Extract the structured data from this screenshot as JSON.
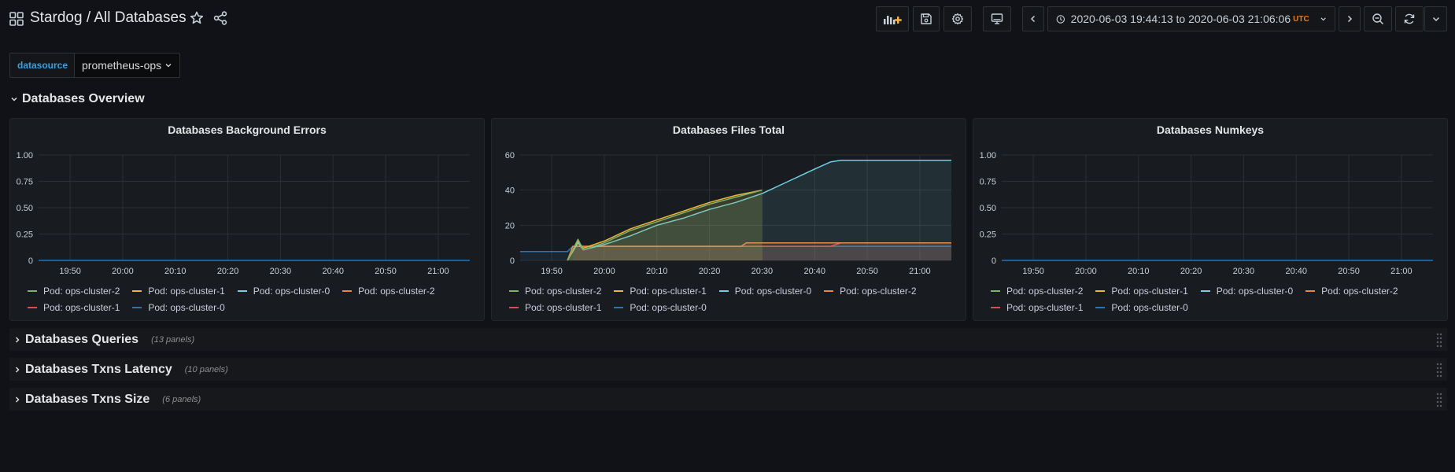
{
  "header": {
    "title": "Stardog / All Databases",
    "time_range": {
      "text": "2020-06-03 19:44:13 to 2020-06-03 21:06:06",
      "tz": "UTC"
    }
  },
  "variables": {
    "label": "datasource",
    "value": "prometheus-ops"
  },
  "rows": {
    "overview": {
      "title": "Databases Overview"
    },
    "collapsed": [
      {
        "title": "Databases Queries",
        "count": "(13 panels)"
      },
      {
        "title": "Databases Txns Latency",
        "count": "(10 panels)"
      },
      {
        "title": "Databases Txns Size",
        "count": "(6 panels)"
      }
    ]
  },
  "colors": {
    "ops-cluster-2-green": "#7eb26d",
    "ops-cluster-1-yellow": "#eab839",
    "ops-cluster-0-cyan": "#6ed0e0",
    "ops-cluster-2-orange": "#ef843c",
    "ops-cluster-1-red": "#e24d42",
    "ops-cluster-0-blue": "#1f78c1"
  },
  "panels": [
    {
      "title": "Databases Background Errors",
      "legend": [
        {
          "label": "Pod: ops-cluster-2",
          "color": "#7eb26d"
        },
        {
          "label": "Pod: ops-cluster-1",
          "color": "#eab839"
        },
        {
          "label": "Pod: ops-cluster-0",
          "color": "#6ed0e0"
        },
        {
          "label": "Pod: ops-cluster-2",
          "color": "#ef843c"
        },
        {
          "label": "Pod: ops-cluster-1",
          "color": "#e24d42"
        },
        {
          "label": "Pod: ops-cluster-0",
          "color": "#1f78c1"
        }
      ]
    },
    {
      "title": "Databases Files Total",
      "legend": [
        {
          "label": "Pod: ops-cluster-2",
          "color": "#7eb26d"
        },
        {
          "label": "Pod: ops-cluster-1",
          "color": "#eab839"
        },
        {
          "label": "Pod: ops-cluster-0",
          "color": "#6ed0e0"
        },
        {
          "label": "Pod: ops-cluster-2",
          "color": "#ef843c"
        },
        {
          "label": "Pod: ops-cluster-1",
          "color": "#e24d42"
        },
        {
          "label": "Pod: ops-cluster-0",
          "color": "#1f78c1"
        }
      ]
    },
    {
      "title": "Databases Numkeys",
      "legend": [
        {
          "label": "Pod: ops-cluster-2",
          "color": "#7eb26d"
        },
        {
          "label": "Pod: ops-cluster-1",
          "color": "#eab839"
        },
        {
          "label": "Pod: ops-cluster-0",
          "color": "#6ed0e0"
        },
        {
          "label": "Pod: ops-cluster-2",
          "color": "#ef843c"
        },
        {
          "label": "Pod: ops-cluster-1",
          "color": "#e24d42"
        },
        {
          "label": "Pod: ops-cluster-0",
          "color": "#1f78c1"
        }
      ]
    }
  ],
  "chart_data": [
    {
      "type": "line",
      "title": "Databases Background Errors",
      "x_ticks": [
        "19:50",
        "20:00",
        "20:10",
        "20:20",
        "20:30",
        "20:40",
        "20:50",
        "21:00"
      ],
      "y_ticks": [
        "0",
        "0.25",
        "0.50",
        "0.75",
        "1.00"
      ],
      "ylim": [
        0,
        1
      ],
      "xlim": [
        "19:44",
        "21:06"
      ],
      "grid": true,
      "legend_position": "bottom",
      "series": [
        {
          "name": "Pod: ops-cluster-0",
          "color": "#1f78c1",
          "x": [
            "19:44",
            "21:06"
          ],
          "y": [
            0,
            0
          ]
        }
      ]
    },
    {
      "type": "area",
      "title": "Databases Files Total",
      "x_ticks": [
        "19:50",
        "20:00",
        "20:10",
        "20:20",
        "20:30",
        "20:40",
        "20:50",
        "21:00"
      ],
      "y_ticks": [
        "0",
        "20",
        "40",
        "60"
      ],
      "ylim": [
        0,
        60
      ],
      "xlim": [
        "19:44",
        "21:06"
      ],
      "grid": true,
      "legend_position": "bottom",
      "series": [
        {
          "name": "Pod: ops-cluster-2",
          "color": "#7eb26d",
          "x": [
            "19:53",
            "19:55",
            "19:56",
            "19:58",
            "20:00",
            "20:05",
            "20:10",
            "20:15",
            "20:20",
            "20:25",
            "20:30"
          ],
          "y": [
            0,
            12,
            6,
            8,
            10,
            17,
            22,
            27,
            32,
            36,
            40
          ]
        },
        {
          "name": "Pod: ops-cluster-1",
          "color": "#eab839",
          "x": [
            "19:53",
            "19:55",
            "19:56",
            "19:58",
            "20:00",
            "20:05",
            "20:10",
            "20:15",
            "20:20",
            "20:25",
            "20:30"
          ],
          "y": [
            0,
            11,
            7,
            9,
            11,
            18,
            23,
            28,
            33,
            37,
            40
          ]
        },
        {
          "name": "Pod: ops-cluster-0",
          "color": "#6ed0e0",
          "x": [
            "19:53",
            "19:55",
            "19:56",
            "20:00",
            "20:05",
            "20:10",
            "20:15",
            "20:20",
            "20:25",
            "20:30",
            "20:35",
            "20:40",
            "20:43",
            "20:45",
            "21:06"
          ],
          "y": [
            0,
            10,
            6,
            9,
            14,
            20,
            24,
            29,
            33,
            38,
            45,
            52,
            56,
            57,
            57
          ]
        },
        {
          "name": "Pod: ops-cluster-2",
          "color": "#ef843c",
          "x": [
            "19:53",
            "19:54",
            "20:26",
            "20:27",
            "21:06"
          ],
          "y": [
            0,
            8,
            8,
            10,
            10
          ]
        },
        {
          "name": "Pod: ops-cluster-1",
          "color": "#e24d42",
          "x": [
            "19:54",
            "20:43",
            "20:45",
            "21:06"
          ],
          "y": [
            8,
            8,
            10,
            10
          ]
        },
        {
          "name": "Pod: ops-cluster-0",
          "color": "#1f78c1",
          "x": [
            "19:44",
            "19:53",
            "19:54",
            "21:06"
          ],
          "y": [
            5,
            5,
            8,
            8
          ]
        }
      ]
    },
    {
      "type": "line",
      "title": "Databases Numkeys",
      "x_ticks": [
        "19:50",
        "20:00",
        "20:10",
        "20:20",
        "20:30",
        "20:40",
        "20:50",
        "21:00"
      ],
      "y_ticks": [
        "0",
        "0.25",
        "0.50",
        "0.75",
        "1.00"
      ],
      "ylim": [
        0,
        1
      ],
      "xlim": [
        "19:44",
        "21:06"
      ],
      "grid": true,
      "legend_position": "bottom",
      "series": [
        {
          "name": "Pod: ops-cluster-0",
          "color": "#1f78c1",
          "x": [
            "19:44",
            "21:06"
          ],
          "y": [
            0,
            0
          ]
        }
      ]
    }
  ]
}
